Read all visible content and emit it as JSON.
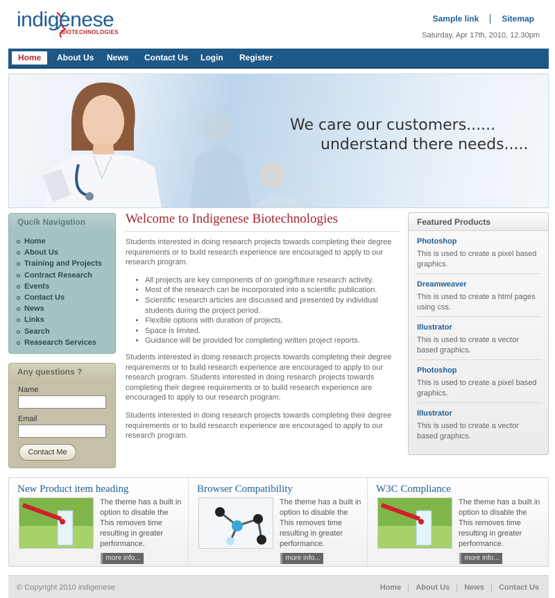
{
  "logo": {
    "wordmark": "indigenese",
    "sub": "BIOTECHNOLOGIES"
  },
  "toplinks": {
    "sample": "Sample link",
    "sitemap": "Sitemap"
  },
  "date": "Saturday, Apr 17th, 2010, 12.30pm",
  "nav": [
    "Home",
    "About Us",
    "News",
    "Contact Us",
    "Login",
    "Register"
  ],
  "banner": {
    "line1": "We care our customers......",
    "line2": "understand there needs....."
  },
  "quick_nav": {
    "title": "Qucik Navigation",
    "items": [
      "Home",
      "About Us",
      "Training and Projects",
      "Contract Research",
      "Events",
      "Contact Us",
      "News",
      "Links",
      "Search",
      "Reasearch Services"
    ]
  },
  "questions": {
    "title": "Any questions ?",
    "name_label": "Name",
    "email_label": "Email",
    "button": "Contact Me"
  },
  "main": {
    "title": "Welcome to Indigenese Biotechnologies",
    "p1": "Students interested in doing research projects towards completing their degree requirements or to build research experience are encouraged to apply to our research program.",
    "bullets": [
      "All projects are key components of on going/future research activity.",
      "Most of the research can be incorporated into a scientific publication.",
      "Scientific research articles are discussed and presented by individual students during the project period.",
      "Flexible options with duration of projects.",
      "Space is limited.",
      "Guidance will be provided for completing written project reports."
    ],
    "p2": "Students interested in doing research projects towards completing their degree requirements or to build research experience are encouraged to apply to our research program. Students interested in doing research projects towards completing their degree requirements or to build research experience are encouraged to apply to our research program.",
    "p3": "Students interested in doing research projects towards completing their degree requirements or to build research experience are encouraged to apply to our research program."
  },
  "featured": {
    "title": "Featured Products",
    "items": [
      {
        "name": "Photoshop",
        "desc": "This is used to create a pixel based graphics."
      },
      {
        "name": "Dreamweaver",
        "desc": "This is used to create a html pages using css."
      },
      {
        "name": "Illustrator",
        "desc": "This is used to create a vector based graphics."
      },
      {
        "name": "Photoshop",
        "desc": "This is used to create a pixel based graphics."
      },
      {
        "name": "Illustrator",
        "desc": "This is used to create a vector based graphics."
      }
    ]
  },
  "bottom": [
    {
      "heading": "New Product item heading",
      "text": "The theme has a built in option to disable the This removes time resulting in greater performance.",
      "more": "more info..."
    },
    {
      "heading": "Browser Compatibility",
      "text": "The theme has a built in option to disable the This removes time resulting in greater performance.",
      "more": "more info..."
    },
    {
      "heading": "W3C Compliance",
      "text": "The theme has a built in option to disable the This removes time resulting in greater performance.",
      "more": "more info..."
    }
  ],
  "footer": {
    "copyright": "© Copyright 2010 indigenese",
    "links": [
      "Home",
      "About Us",
      "News",
      "Contact Us"
    ]
  },
  "colors": {
    "brand_blue": "#1e5887",
    "accent_red": "#a8252d",
    "nav_text": "#ffffff"
  }
}
